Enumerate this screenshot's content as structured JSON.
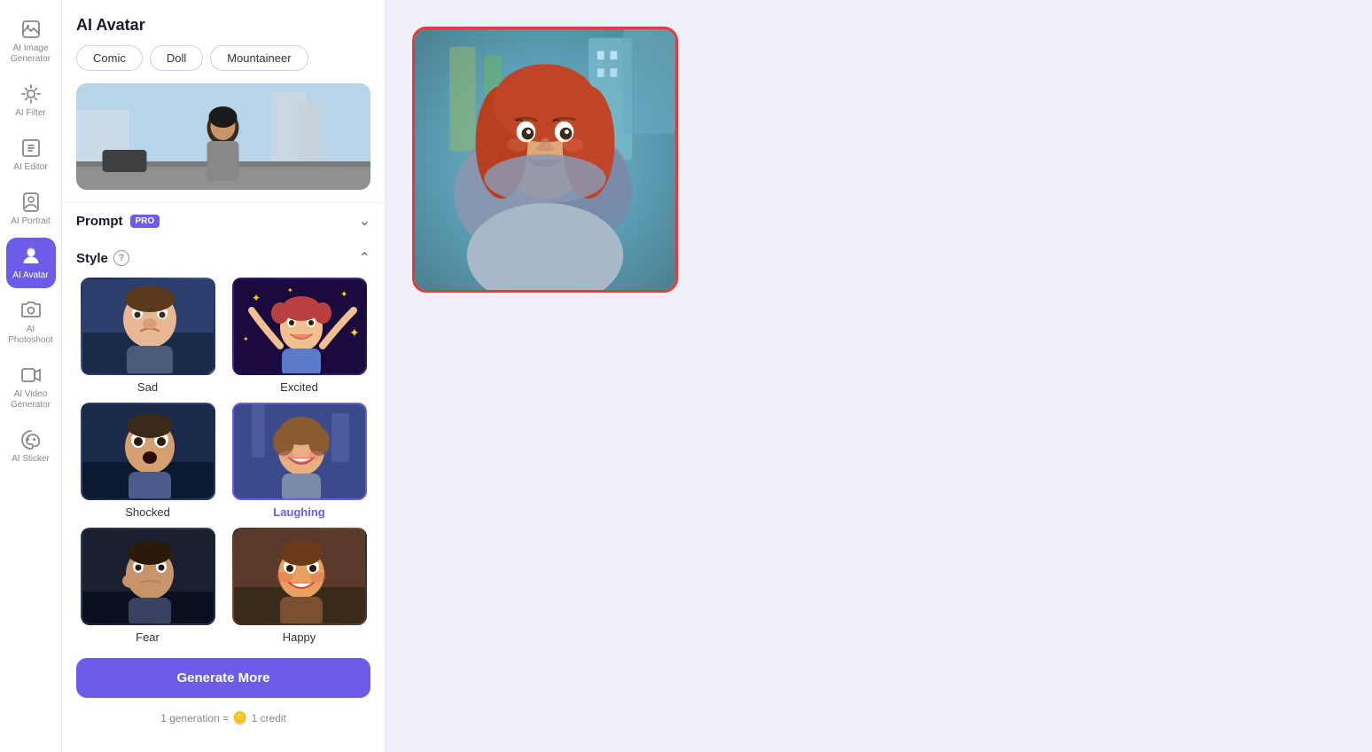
{
  "app": {
    "title": "AI Avatar"
  },
  "sidebar": {
    "items": [
      {
        "id": "ai-image-generator",
        "label": "AI Image Generator",
        "icon": "image-gen-icon",
        "active": false
      },
      {
        "id": "ai-filter",
        "label": "AI Filter",
        "icon": "filter-icon",
        "active": false
      },
      {
        "id": "ai-editor",
        "label": "AI Editor",
        "icon": "editor-icon",
        "active": false
      },
      {
        "id": "ai-portrait",
        "label": "AI Portrait",
        "icon": "portrait-icon",
        "active": false
      },
      {
        "id": "ai-avatar",
        "label": "AI Avatar",
        "icon": "avatar-icon",
        "active": true
      },
      {
        "id": "ai-photoshoot",
        "label": "AI Photoshoot",
        "icon": "photoshoot-icon",
        "active": false
      },
      {
        "id": "ai-video-generator",
        "label": "AI Video Generator",
        "icon": "video-icon",
        "active": false
      },
      {
        "id": "ai-sticker",
        "label": "AI Sticker",
        "icon": "sticker-icon",
        "active": false
      }
    ]
  },
  "panel": {
    "title": "AI Avatar",
    "chips": [
      "Comic",
      "Doll",
      "Mountaineer"
    ],
    "prompt": {
      "label": "Prompt",
      "badge": "PRO"
    },
    "style": {
      "title": "Style",
      "items": [
        {
          "id": "sad",
          "label": "Sad",
          "selected": false
        },
        {
          "id": "excited",
          "label": "Excited",
          "selected": false
        },
        {
          "id": "shocked",
          "label": "Shocked",
          "selected": false
        },
        {
          "id": "laughing",
          "label": "Laughing",
          "selected": true
        },
        {
          "id": "fear",
          "label": "Fear",
          "selected": false
        },
        {
          "id": "happy",
          "label": "Happy",
          "selected": false
        }
      ]
    },
    "generate_btn": "Generate More",
    "credit_text_before": "1 generation =",
    "credit_text_after": "1 credit"
  }
}
